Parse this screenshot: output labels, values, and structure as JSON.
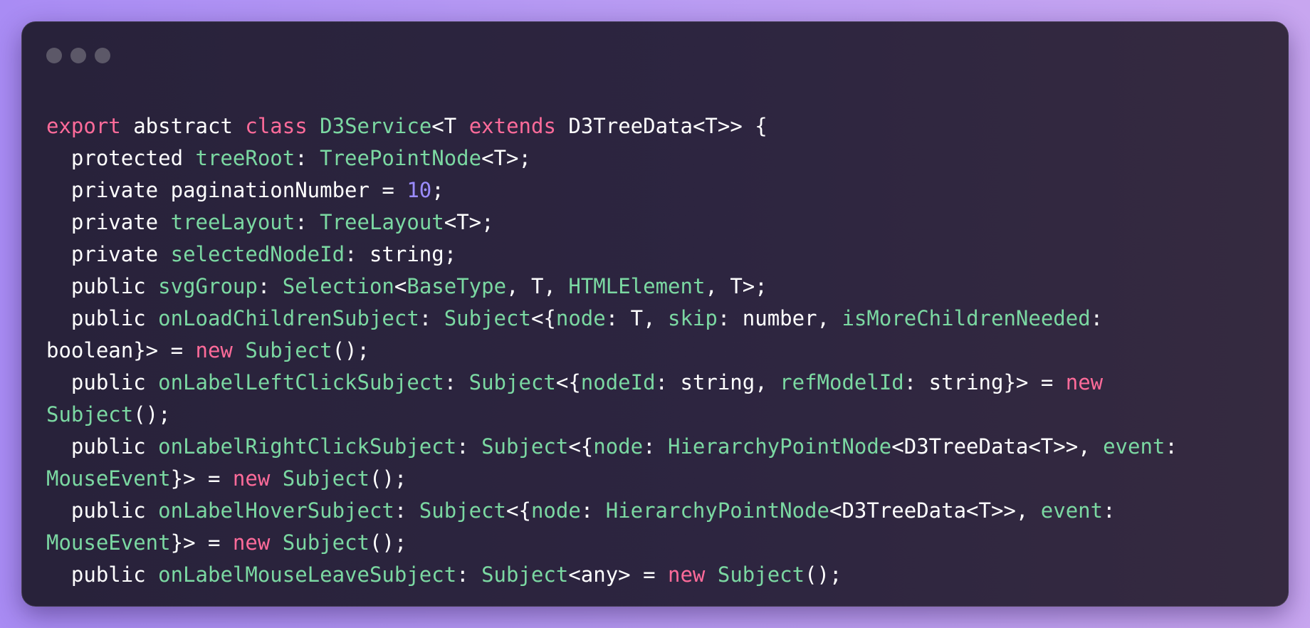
{
  "window": {
    "title": "",
    "controls": [
      "window-dot-1",
      "window-dot-2",
      "window-dot-3"
    ]
  },
  "code": {
    "language": "typescript",
    "lines": [
      [
        {
          "t": "export",
          "c": "kw"
        },
        {
          "t": " abstract ",
          "c": "plain"
        },
        {
          "t": "class",
          "c": "kw"
        },
        {
          "t": " ",
          "c": "plain"
        },
        {
          "t": "D3Service",
          "c": "id"
        },
        {
          "t": "<T ",
          "c": "plain"
        },
        {
          "t": "extends",
          "c": "kw"
        },
        {
          "t": " D3TreeData<T>> {",
          "c": "plain"
        }
      ],
      [
        {
          "t": "  protected ",
          "c": "plain"
        },
        {
          "t": "treeRoot",
          "c": "id"
        },
        {
          "t": ": ",
          "c": "plain"
        },
        {
          "t": "TreePointNode",
          "c": "id"
        },
        {
          "t": "<T>;",
          "c": "plain"
        }
      ],
      [
        {
          "t": "  private paginationNumber = ",
          "c": "plain"
        },
        {
          "t": "10",
          "c": "num"
        },
        {
          "t": ";",
          "c": "plain"
        }
      ],
      [
        {
          "t": "  private ",
          "c": "plain"
        },
        {
          "t": "treeLayout",
          "c": "id"
        },
        {
          "t": ": ",
          "c": "plain"
        },
        {
          "t": "TreeLayout",
          "c": "id"
        },
        {
          "t": "<T>;",
          "c": "plain"
        }
      ],
      [
        {
          "t": "  private ",
          "c": "plain"
        },
        {
          "t": "selectedNodeId",
          "c": "id"
        },
        {
          "t": ": string;",
          "c": "plain"
        }
      ],
      [
        {
          "t": "  public ",
          "c": "plain"
        },
        {
          "t": "svgGroup",
          "c": "id"
        },
        {
          "t": ": ",
          "c": "plain"
        },
        {
          "t": "Selection",
          "c": "id"
        },
        {
          "t": "<",
          "c": "plain"
        },
        {
          "t": "BaseType",
          "c": "id"
        },
        {
          "t": ", T, ",
          "c": "plain"
        },
        {
          "t": "HTMLElement",
          "c": "id"
        },
        {
          "t": ", T>;",
          "c": "plain"
        }
      ],
      [
        {
          "t": "  public ",
          "c": "plain"
        },
        {
          "t": "onLoadChildrenSubject",
          "c": "id"
        },
        {
          "t": ": ",
          "c": "plain"
        },
        {
          "t": "Subject",
          "c": "id"
        },
        {
          "t": "<{",
          "c": "plain"
        },
        {
          "t": "node",
          "c": "id"
        },
        {
          "t": ": T, ",
          "c": "plain"
        },
        {
          "t": "skip",
          "c": "id"
        },
        {
          "t": ": number, ",
          "c": "plain"
        },
        {
          "t": "isMoreChildrenNeeded",
          "c": "id"
        },
        {
          "t": ":",
          "c": "plain"
        }
      ],
      [
        {
          "t": "boolean}> = ",
          "c": "plain"
        },
        {
          "t": "new",
          "c": "kw"
        },
        {
          "t": " ",
          "c": "plain"
        },
        {
          "t": "Subject",
          "c": "id"
        },
        {
          "t": "();",
          "c": "plain"
        }
      ],
      [
        {
          "t": "  public ",
          "c": "plain"
        },
        {
          "t": "onLabelLeftClickSubject",
          "c": "id"
        },
        {
          "t": ": ",
          "c": "plain"
        },
        {
          "t": "Subject",
          "c": "id"
        },
        {
          "t": "<{",
          "c": "plain"
        },
        {
          "t": "nodeId",
          "c": "id"
        },
        {
          "t": ": string, ",
          "c": "plain"
        },
        {
          "t": "refModelId",
          "c": "id"
        },
        {
          "t": ": string}> = ",
          "c": "plain"
        },
        {
          "t": "new",
          "c": "kw"
        }
      ],
      [
        {
          "t": "Subject",
          "c": "id"
        },
        {
          "t": "();",
          "c": "plain"
        }
      ],
      [
        {
          "t": "  public ",
          "c": "plain"
        },
        {
          "t": "onLabelRightClickSubject",
          "c": "id"
        },
        {
          "t": ": ",
          "c": "plain"
        },
        {
          "t": "Subject",
          "c": "id"
        },
        {
          "t": "<{",
          "c": "plain"
        },
        {
          "t": "node",
          "c": "id"
        },
        {
          "t": ": ",
          "c": "plain"
        },
        {
          "t": "HierarchyPointNode",
          "c": "id"
        },
        {
          "t": "<D3TreeData<T>>, ",
          "c": "plain"
        },
        {
          "t": "event",
          "c": "id"
        },
        {
          "t": ":",
          "c": "plain"
        }
      ],
      [
        {
          "t": "MouseEvent",
          "c": "id"
        },
        {
          "t": "}> = ",
          "c": "plain"
        },
        {
          "t": "new",
          "c": "kw"
        },
        {
          "t": " ",
          "c": "plain"
        },
        {
          "t": "Subject",
          "c": "id"
        },
        {
          "t": "();",
          "c": "plain"
        }
      ],
      [
        {
          "t": "  public ",
          "c": "plain"
        },
        {
          "t": "onLabelHoverSubject",
          "c": "id"
        },
        {
          "t": ": ",
          "c": "plain"
        },
        {
          "t": "Subject",
          "c": "id"
        },
        {
          "t": "<{",
          "c": "plain"
        },
        {
          "t": "node",
          "c": "id"
        },
        {
          "t": ": ",
          "c": "plain"
        },
        {
          "t": "HierarchyPointNode",
          "c": "id"
        },
        {
          "t": "<D3TreeData<T>>, ",
          "c": "plain"
        },
        {
          "t": "event",
          "c": "id"
        },
        {
          "t": ":",
          "c": "plain"
        }
      ],
      [
        {
          "t": "MouseEvent",
          "c": "id"
        },
        {
          "t": "}> = ",
          "c": "plain"
        },
        {
          "t": "new",
          "c": "kw"
        },
        {
          "t": " ",
          "c": "plain"
        },
        {
          "t": "Subject",
          "c": "id"
        },
        {
          "t": "();",
          "c": "plain"
        }
      ],
      [
        {
          "t": "  public ",
          "c": "plain"
        },
        {
          "t": "onLabelMouseLeaveSubject",
          "c": "id"
        },
        {
          "t": ": ",
          "c": "plain"
        },
        {
          "t": "Subject",
          "c": "id"
        },
        {
          "t": "<any> = ",
          "c": "plain"
        },
        {
          "t": "new",
          "c": "kw"
        },
        {
          "t": " ",
          "c": "plain"
        },
        {
          "t": "Subject",
          "c": "id"
        },
        {
          "t": "();",
          "c": "plain"
        }
      ]
    ]
  },
  "colors": {
    "background_start": "#a98cf4",
    "background_end": "#c8a6f0",
    "window": "#2d2540",
    "keyword": "#ff6b9a",
    "identifier": "#7bd8a2",
    "number": "#9b8cff",
    "plain": "#ffffff",
    "window_dot": "#5c5868"
  }
}
